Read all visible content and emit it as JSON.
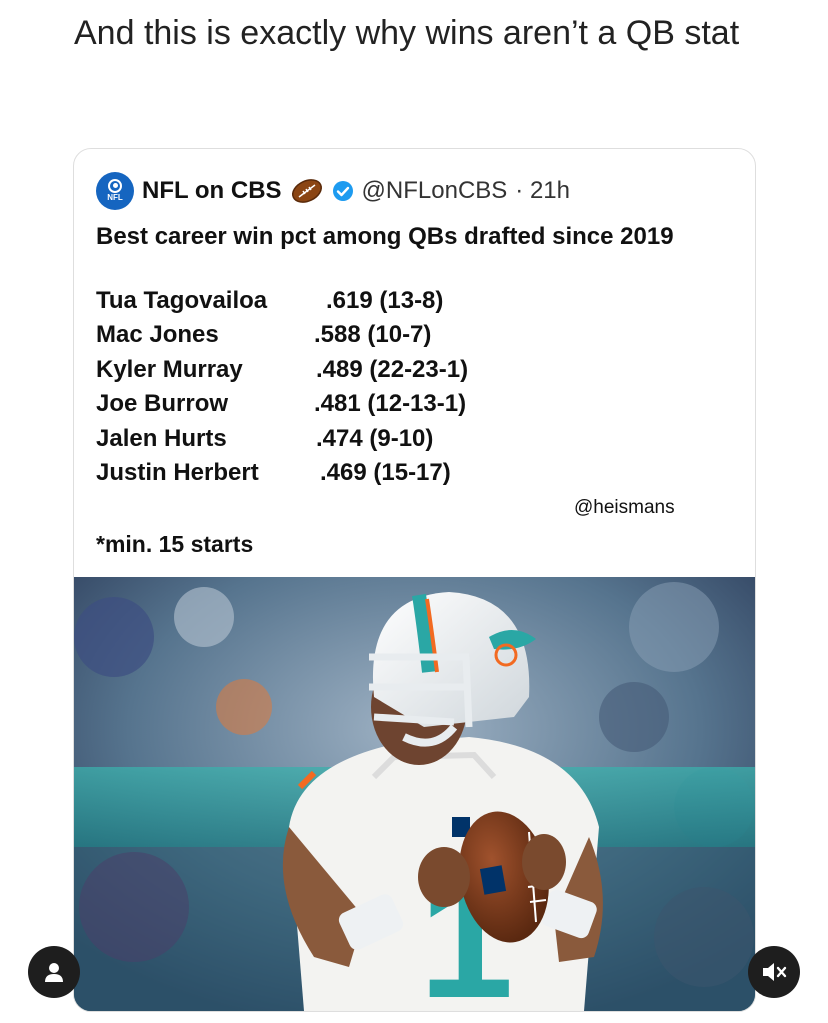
{
  "post": {
    "caption": "And this is exactly why wins aren’t a QB stat"
  },
  "tweet": {
    "author_name": "NFL on CBS",
    "avatar_text": "NFL",
    "handle": "@NFLonCBS",
    "time": "· 21h",
    "text": "Best career win pct among QBs drafted since 2019",
    "rows": [
      {
        "player": "Tua Tagovailoa",
        "record": ".619 (13-8)"
      },
      {
        "player": "Mac Jones",
        "record": ".588 (10-7)"
      },
      {
        "player": "Kyler Murray",
        "record": ".489 (22-23-1)"
      },
      {
        "player": "Joe Burrow",
        "record": ".481 (12-13-1)"
      },
      {
        "player": "Jalen Hurts",
        "record": ".474 (9-10)"
      },
      {
        "player": "Justin Herbert",
        "record": ".469 (15-17)"
      }
    ],
    "credit": "@heismans",
    "footnote": "*min. 15 starts"
  },
  "photo": {
    "jersey_number": "1"
  },
  "controls": {
    "profile_icon": "person-icon",
    "mute_icon": "speaker-muted-icon"
  },
  "colors": {
    "brand_blue": "#1565c0",
    "verified_blue": "#1d9bf0",
    "dolphins_aqua": "#2aa7a5",
    "dolphins_orange": "#f26a21"
  }
}
